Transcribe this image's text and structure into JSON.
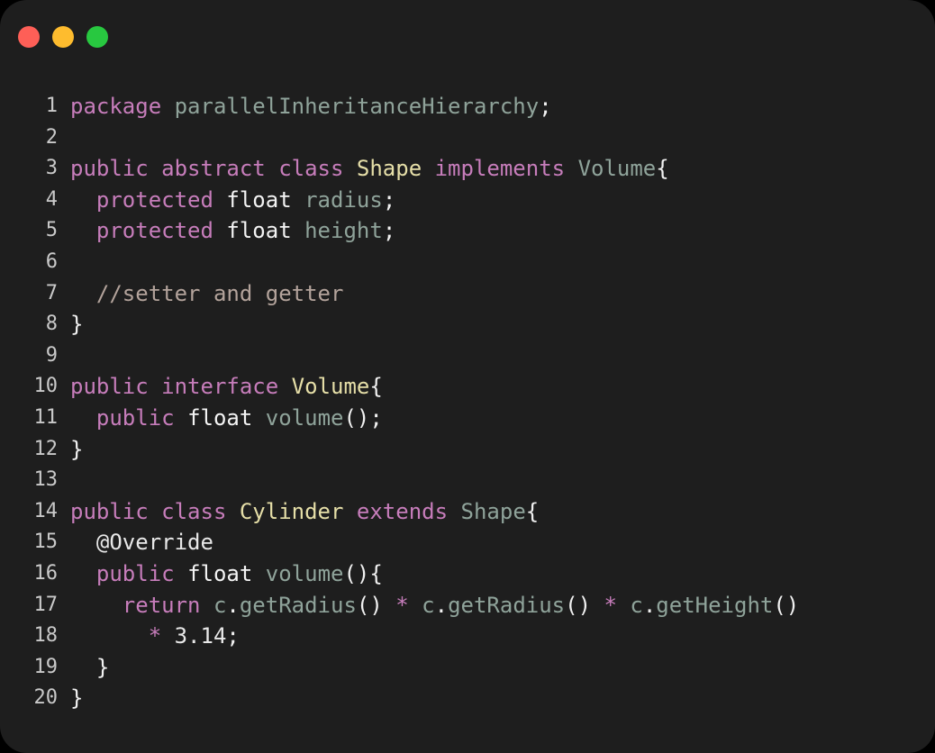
{
  "window": {
    "buttons": [
      {
        "name": "close",
        "color": "#fe5f57"
      },
      {
        "name": "minimize",
        "color": "#febc2e"
      },
      {
        "name": "zoom",
        "color": "#28c840"
      }
    ]
  },
  "colors": {
    "keyword": "#c77dbb",
    "type": "#f4f4f4",
    "identifier": "#8fa39a",
    "class": "#e6dfa8",
    "comment": "#b3a39b",
    "punctuation": "#f1f1f1"
  },
  "code": {
    "lines": [
      {
        "num": "1",
        "tokens": [
          {
            "t": "package",
            "k": "keyword"
          },
          {
            "t": " ",
            "k": "plain"
          },
          {
            "t": "parallelInheritanceHierarchy",
            "k": "ident"
          },
          {
            "t": ";",
            "k": "punct"
          }
        ]
      },
      {
        "num": "2",
        "tokens": []
      },
      {
        "num": "3",
        "tokens": [
          {
            "t": "public",
            "k": "keyword"
          },
          {
            "t": " ",
            "k": "plain"
          },
          {
            "t": "abstract",
            "k": "keyword"
          },
          {
            "t": " ",
            "k": "plain"
          },
          {
            "t": "class",
            "k": "keyword"
          },
          {
            "t": " ",
            "k": "plain"
          },
          {
            "t": "Shape",
            "k": "class"
          },
          {
            "t": " ",
            "k": "plain"
          },
          {
            "t": "implements",
            "k": "keyword"
          },
          {
            "t": " ",
            "k": "plain"
          },
          {
            "t": "Volume",
            "k": "ident"
          },
          {
            "t": "{",
            "k": "punct"
          }
        ]
      },
      {
        "num": "4",
        "tokens": [
          {
            "t": "  ",
            "k": "plain"
          },
          {
            "t": "protected",
            "k": "keyword"
          },
          {
            "t": " ",
            "k": "plain"
          },
          {
            "t": "float",
            "k": "type"
          },
          {
            "t": " ",
            "k": "plain"
          },
          {
            "t": "radius",
            "k": "ident"
          },
          {
            "t": ";",
            "k": "punct"
          }
        ]
      },
      {
        "num": "5",
        "tokens": [
          {
            "t": "  ",
            "k": "plain"
          },
          {
            "t": "protected",
            "k": "keyword"
          },
          {
            "t": " ",
            "k": "plain"
          },
          {
            "t": "float",
            "k": "type"
          },
          {
            "t": " ",
            "k": "plain"
          },
          {
            "t": "height",
            "k": "ident"
          },
          {
            "t": ";",
            "k": "punct"
          }
        ]
      },
      {
        "num": "6",
        "tokens": []
      },
      {
        "num": "7",
        "tokens": [
          {
            "t": "  ",
            "k": "plain"
          },
          {
            "t": "//setter and getter",
            "k": "comment"
          }
        ]
      },
      {
        "num": "8",
        "tokens": [
          {
            "t": "}",
            "k": "punct"
          }
        ]
      },
      {
        "num": "9",
        "tokens": []
      },
      {
        "num": "10",
        "tokens": [
          {
            "t": "public",
            "k": "keyword"
          },
          {
            "t": " ",
            "k": "plain"
          },
          {
            "t": "interface",
            "k": "keyword"
          },
          {
            "t": " ",
            "k": "plain"
          },
          {
            "t": "Volume",
            "k": "class"
          },
          {
            "t": "{",
            "k": "punct"
          }
        ]
      },
      {
        "num": "11",
        "tokens": [
          {
            "t": "  ",
            "k": "plain"
          },
          {
            "t": "public",
            "k": "keyword"
          },
          {
            "t": " ",
            "k": "plain"
          },
          {
            "t": "float",
            "k": "type"
          },
          {
            "t": " ",
            "k": "plain"
          },
          {
            "t": "volume",
            "k": "ident"
          },
          {
            "t": "();",
            "k": "punct"
          }
        ]
      },
      {
        "num": "12",
        "tokens": [
          {
            "t": "}",
            "k": "punct"
          }
        ]
      },
      {
        "num": "13",
        "tokens": []
      },
      {
        "num": "14",
        "tokens": [
          {
            "t": "public",
            "k": "keyword"
          },
          {
            "t": " ",
            "k": "plain"
          },
          {
            "t": "class",
            "k": "keyword"
          },
          {
            "t": " ",
            "k": "plain"
          },
          {
            "t": "Cylinder",
            "k": "class"
          },
          {
            "t": " ",
            "k": "plain"
          },
          {
            "t": "extends",
            "k": "keyword"
          },
          {
            "t": " ",
            "k": "plain"
          },
          {
            "t": "Shape",
            "k": "ident"
          },
          {
            "t": "{",
            "k": "punct"
          }
        ]
      },
      {
        "num": "15",
        "tokens": [
          {
            "t": "  ",
            "k": "plain"
          },
          {
            "t": "@Override",
            "k": "annotation"
          }
        ]
      },
      {
        "num": "16",
        "tokens": [
          {
            "t": "  ",
            "k": "plain"
          },
          {
            "t": "public",
            "k": "keyword"
          },
          {
            "t": " ",
            "k": "plain"
          },
          {
            "t": "float",
            "k": "type"
          },
          {
            "t": " ",
            "k": "plain"
          },
          {
            "t": "volume",
            "k": "ident"
          },
          {
            "t": "(){",
            "k": "punct"
          }
        ]
      },
      {
        "num": "17",
        "tokens": [
          {
            "t": "    ",
            "k": "plain"
          },
          {
            "t": "return",
            "k": "keyword"
          },
          {
            "t": " ",
            "k": "plain"
          },
          {
            "t": "c",
            "k": "ident"
          },
          {
            "t": ".",
            "k": "punct"
          },
          {
            "t": "getRadius",
            "k": "ident"
          },
          {
            "t": "()",
            "k": "punct"
          },
          {
            "t": " ",
            "k": "plain"
          },
          {
            "t": "*",
            "k": "operator"
          },
          {
            "t": " ",
            "k": "plain"
          },
          {
            "t": "c",
            "k": "ident"
          },
          {
            "t": ".",
            "k": "punct"
          },
          {
            "t": "getRadius",
            "k": "ident"
          },
          {
            "t": "()",
            "k": "punct"
          },
          {
            "t": " ",
            "k": "plain"
          },
          {
            "t": "*",
            "k": "operator"
          },
          {
            "t": " ",
            "k": "plain"
          },
          {
            "t": "c",
            "k": "ident"
          },
          {
            "t": ".",
            "k": "punct"
          },
          {
            "t": "getHeight",
            "k": "ident"
          },
          {
            "t": "()",
            "k": "punct"
          }
        ]
      },
      {
        "num": "18",
        "tokens": [
          {
            "t": "      ",
            "k": "plain"
          },
          {
            "t": "*",
            "k": "operator"
          },
          {
            "t": " ",
            "k": "plain"
          },
          {
            "t": "3.14",
            "k": "number"
          },
          {
            "t": ";",
            "k": "punct"
          }
        ]
      },
      {
        "num": "19",
        "tokens": [
          {
            "t": "  ",
            "k": "plain"
          },
          {
            "t": "}",
            "k": "punct"
          }
        ]
      },
      {
        "num": "20",
        "tokens": [
          {
            "t": "}",
            "k": "punct"
          }
        ]
      }
    ]
  }
}
